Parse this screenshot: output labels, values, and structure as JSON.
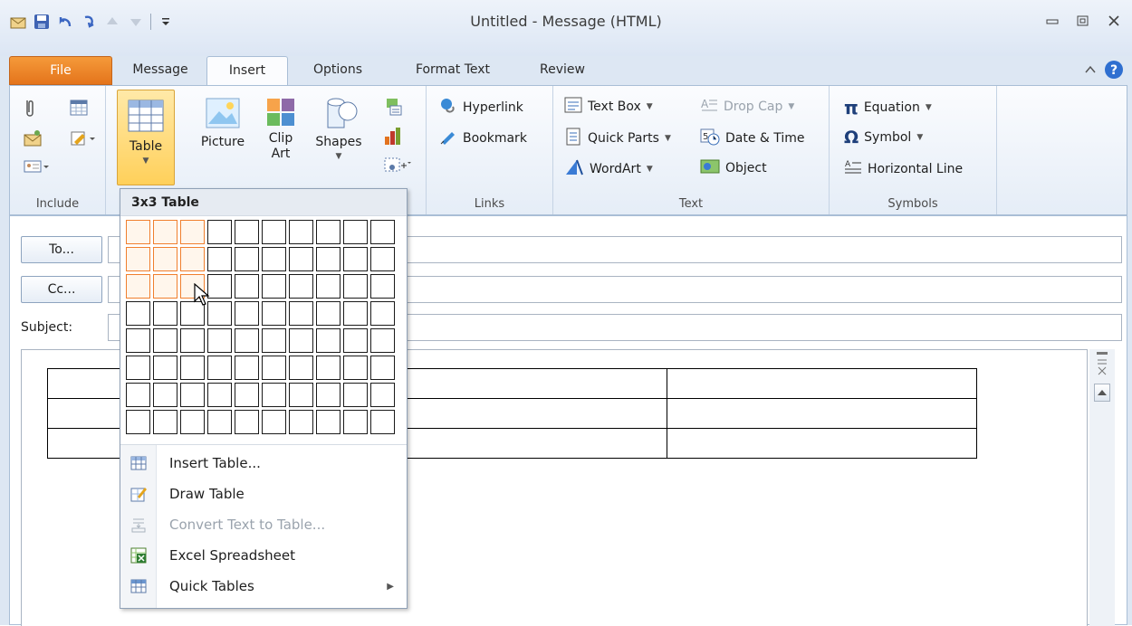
{
  "window": {
    "title": "Untitled - Message (HTML)"
  },
  "tabs": {
    "file": "File",
    "message": "Message",
    "insert": "Insert",
    "options": "Options",
    "format_text": "Format Text",
    "review": "Review"
  },
  "ribbon": {
    "include": {
      "label": "Include"
    },
    "tables": {
      "table_label": "Table"
    },
    "illustrations": {
      "picture": "Picture",
      "clip_art": "Clip Art",
      "shapes": "Shapes"
    },
    "links": {
      "label": "Links",
      "hyperlink": "Hyperlink",
      "bookmark": "Bookmark"
    },
    "text": {
      "label": "Text",
      "text_box": "Text Box",
      "quick_parts": "Quick Parts",
      "wordart": "WordArt",
      "drop_cap": "Drop Cap",
      "date_time": "Date & Time",
      "object": "Object"
    },
    "symbols": {
      "label": "Symbols",
      "equation": "Equation",
      "symbol": "Symbol",
      "horizontal_line": "Horizontal Line"
    }
  },
  "address": {
    "to": "To...",
    "cc": "Cc...",
    "subject": "Subject:"
  },
  "table_menu": {
    "header": "3x3 Table",
    "grid": {
      "rows": 8,
      "cols": 10,
      "selected_rows": 3,
      "selected_cols": 3
    },
    "items": [
      {
        "label": "Insert Table...",
        "icon": "insert-table-icon",
        "disabled": false
      },
      {
        "label": "Draw Table",
        "icon": "draw-table-icon",
        "disabled": false
      },
      {
        "label": "Convert Text to Table...",
        "icon": "convert-text-icon",
        "disabled": true
      },
      {
        "label": "Excel Spreadsheet",
        "icon": "excel-icon",
        "disabled": false
      },
      {
        "label": "Quick Tables",
        "icon": "quick-tables-icon",
        "disabled": false,
        "submenu": true
      }
    ]
  },
  "document_table": {
    "rows": 3,
    "cols": 3
  },
  "colors": {
    "file_tab": "#e4741b",
    "grid_highlight": "#f07f2e",
    "ribbon_bg": "#e5edf7"
  }
}
